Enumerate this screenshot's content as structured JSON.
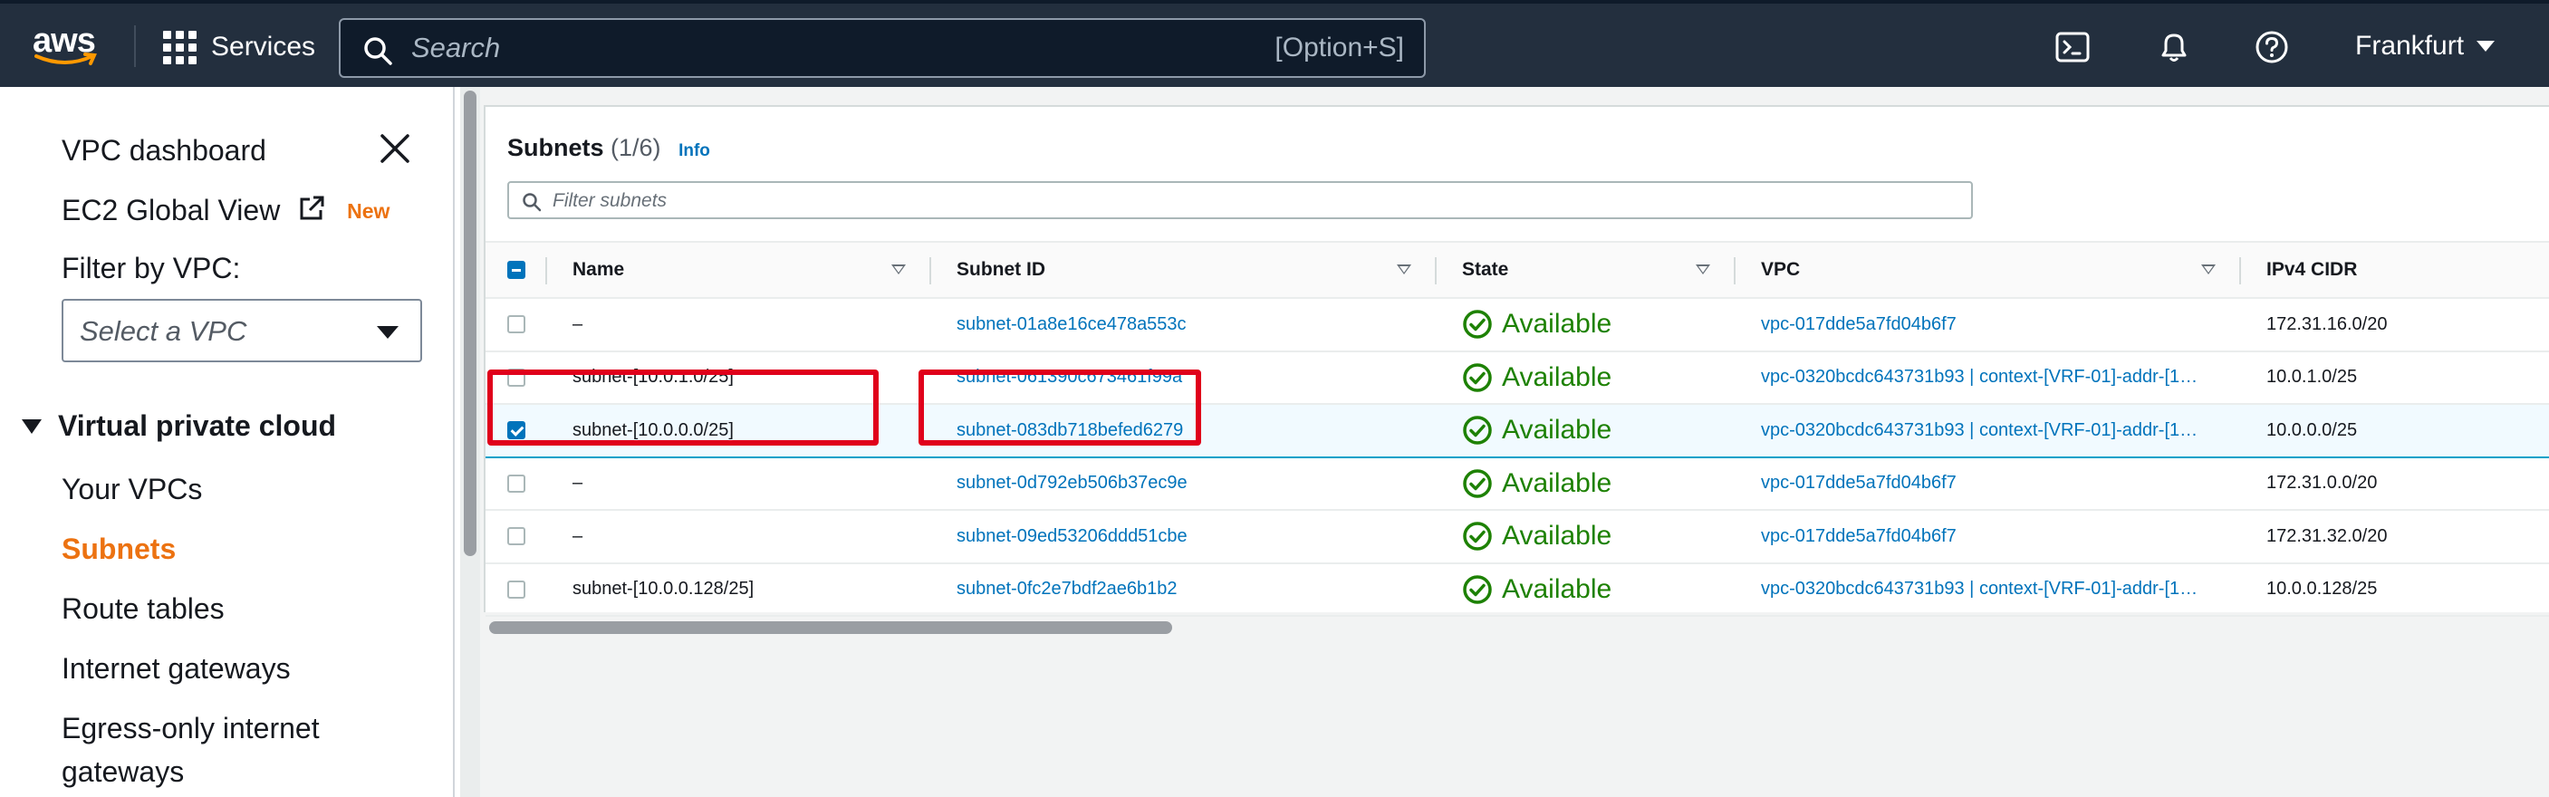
{
  "topnav": {
    "logo_text": "aws",
    "services_label": "Services",
    "search_placeholder": "Search",
    "search_shortcut": "[Option+S]",
    "region": "Frankfurt",
    "icons": [
      "cloudshell-icon",
      "bell-icon",
      "help-icon"
    ]
  },
  "sidebar": {
    "dashboard": "VPC dashboard",
    "ec2_global_view": "EC2 Global View",
    "new_badge": "New",
    "filter_label": "Filter by VPC:",
    "select_placeholder": "Select a VPC",
    "section_title": "Virtual private cloud",
    "items": [
      {
        "label": "Your VPCs"
      },
      {
        "label": "Subnets"
      },
      {
        "label": "Route tables"
      },
      {
        "label": "Internet gateways"
      },
      {
        "label": "Egress-only internet"
      },
      {
        "label": "gateways"
      }
    ]
  },
  "main": {
    "title": "Subnets",
    "count": "(1/6)",
    "info": "Info",
    "filter_placeholder": "Filter subnets",
    "columns": [
      "Name",
      "Subnet ID",
      "State",
      "VPC",
      "IPv4 CIDR"
    ],
    "rows": [
      {
        "name": "–",
        "subnet_id": "subnet-01a8e16ce478a553c",
        "state": "Available",
        "vpc": "vpc-017dde5a7fd04b6f7",
        "cidr": "172.31.16.0/20",
        "checked": false
      },
      {
        "name": "subnet-[10.0.1.0/25]",
        "subnet_id": "subnet-061390c673461f99a",
        "state": "Available",
        "vpc": "vpc-0320bcdc643731b93 | context-[VRF-01]-addr-[1…",
        "cidr": "10.0.1.0/25",
        "checked": false
      },
      {
        "name": "subnet-[10.0.0.0/25]",
        "subnet_id": "subnet-083db718befed6279",
        "state": "Available",
        "vpc": "vpc-0320bcdc643731b93 | context-[VRF-01]-addr-[1…",
        "cidr": "10.0.0.0/25",
        "checked": true
      },
      {
        "name": "–",
        "subnet_id": "subnet-0d792eb506b37ec9e",
        "state": "Available",
        "vpc": "vpc-017dde5a7fd04b6f7",
        "cidr": "172.31.0.0/20",
        "checked": false
      },
      {
        "name": "–",
        "subnet_id": "subnet-09ed53206ddd51cbe",
        "state": "Available",
        "vpc": "vpc-017dde5a7fd04b6f7",
        "cidr": "172.31.32.0/20",
        "checked": false
      },
      {
        "name": "subnet-[10.0.0.128/25]",
        "subnet_id": "subnet-0fc2e7bdf2ae6b1b2",
        "state": "Available",
        "vpc": "vpc-0320bcdc643731b93 | context-[VRF-01]-addr-[1…",
        "cidr": "10.0.0.128/25",
        "checked": false
      }
    ]
  },
  "colors": {
    "nav_bg": "#232f3e",
    "accent": "#ec7211",
    "link": "#0073bb",
    "success": "#1d8102",
    "highlight_box": "#e0001b"
  }
}
